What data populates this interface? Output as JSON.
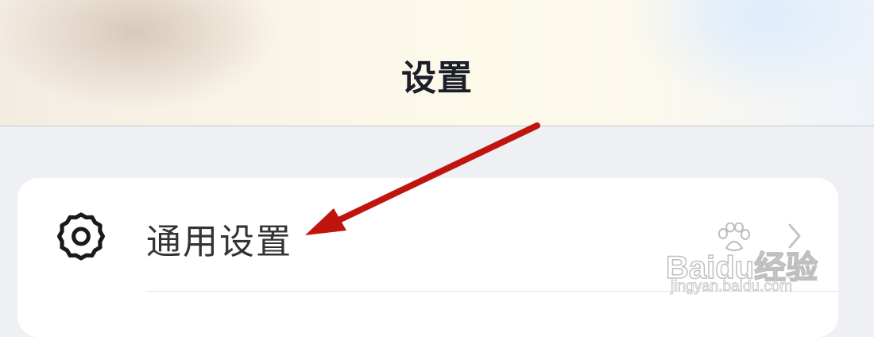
{
  "header": {
    "title": "设置"
  },
  "settings_list": {
    "items": [
      {
        "label": "通用设置",
        "icon": "gear-icon",
        "chevron": "chevron-right-icon"
      }
    ]
  },
  "annotation": {
    "arrow_color": "#c0150f"
  },
  "watermark": {
    "brand": "Baidu经验",
    "url": "jingyan.baidu.com"
  },
  "colors": {
    "page_background": "#eff0f4",
    "card_background": "#ffffff",
    "title_text": "#1c1f2a",
    "label_text": "#333333"
  }
}
